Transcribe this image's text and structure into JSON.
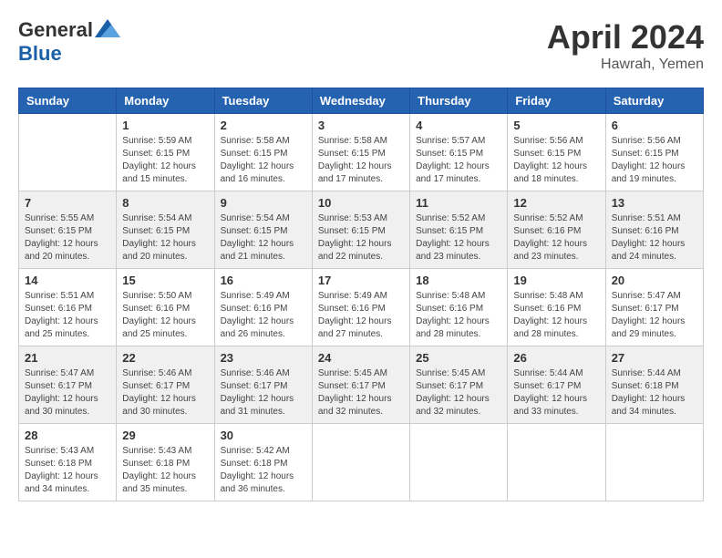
{
  "header": {
    "logo_general": "General",
    "logo_blue": "Blue",
    "month_year": "April 2024",
    "location": "Hawrah, Yemen"
  },
  "days_of_week": [
    "Sunday",
    "Monday",
    "Tuesday",
    "Wednesday",
    "Thursday",
    "Friday",
    "Saturday"
  ],
  "weeks": [
    [
      {
        "day": "",
        "sunrise": "",
        "sunset": "",
        "daylight": ""
      },
      {
        "day": "1",
        "sunrise": "Sunrise: 5:59 AM",
        "sunset": "Sunset: 6:15 PM",
        "daylight": "Daylight: 12 hours and 15 minutes."
      },
      {
        "day": "2",
        "sunrise": "Sunrise: 5:58 AM",
        "sunset": "Sunset: 6:15 PM",
        "daylight": "Daylight: 12 hours and 16 minutes."
      },
      {
        "day": "3",
        "sunrise": "Sunrise: 5:58 AM",
        "sunset": "Sunset: 6:15 PM",
        "daylight": "Daylight: 12 hours and 17 minutes."
      },
      {
        "day": "4",
        "sunrise": "Sunrise: 5:57 AM",
        "sunset": "Sunset: 6:15 PM",
        "daylight": "Daylight: 12 hours and 17 minutes."
      },
      {
        "day": "5",
        "sunrise": "Sunrise: 5:56 AM",
        "sunset": "Sunset: 6:15 PM",
        "daylight": "Daylight: 12 hours and 18 minutes."
      },
      {
        "day": "6",
        "sunrise": "Sunrise: 5:56 AM",
        "sunset": "Sunset: 6:15 PM",
        "daylight": "Daylight: 12 hours and 19 minutes."
      }
    ],
    [
      {
        "day": "7",
        "sunrise": "Sunrise: 5:55 AM",
        "sunset": "Sunset: 6:15 PM",
        "daylight": "Daylight: 12 hours and 20 minutes."
      },
      {
        "day": "8",
        "sunrise": "Sunrise: 5:54 AM",
        "sunset": "Sunset: 6:15 PM",
        "daylight": "Daylight: 12 hours and 20 minutes."
      },
      {
        "day": "9",
        "sunrise": "Sunrise: 5:54 AM",
        "sunset": "Sunset: 6:15 PM",
        "daylight": "Daylight: 12 hours and 21 minutes."
      },
      {
        "day": "10",
        "sunrise": "Sunrise: 5:53 AM",
        "sunset": "Sunset: 6:15 PM",
        "daylight": "Daylight: 12 hours and 22 minutes."
      },
      {
        "day": "11",
        "sunrise": "Sunrise: 5:52 AM",
        "sunset": "Sunset: 6:15 PM",
        "daylight": "Daylight: 12 hours and 23 minutes."
      },
      {
        "day": "12",
        "sunrise": "Sunrise: 5:52 AM",
        "sunset": "Sunset: 6:16 PM",
        "daylight": "Daylight: 12 hours and 23 minutes."
      },
      {
        "day": "13",
        "sunrise": "Sunrise: 5:51 AM",
        "sunset": "Sunset: 6:16 PM",
        "daylight": "Daylight: 12 hours and 24 minutes."
      }
    ],
    [
      {
        "day": "14",
        "sunrise": "Sunrise: 5:51 AM",
        "sunset": "Sunset: 6:16 PM",
        "daylight": "Daylight: 12 hours and 25 minutes."
      },
      {
        "day": "15",
        "sunrise": "Sunrise: 5:50 AM",
        "sunset": "Sunset: 6:16 PM",
        "daylight": "Daylight: 12 hours and 25 minutes."
      },
      {
        "day": "16",
        "sunrise": "Sunrise: 5:49 AM",
        "sunset": "Sunset: 6:16 PM",
        "daylight": "Daylight: 12 hours and 26 minutes."
      },
      {
        "day": "17",
        "sunrise": "Sunrise: 5:49 AM",
        "sunset": "Sunset: 6:16 PM",
        "daylight": "Daylight: 12 hours and 27 minutes."
      },
      {
        "day": "18",
        "sunrise": "Sunrise: 5:48 AM",
        "sunset": "Sunset: 6:16 PM",
        "daylight": "Daylight: 12 hours and 28 minutes."
      },
      {
        "day": "19",
        "sunrise": "Sunrise: 5:48 AM",
        "sunset": "Sunset: 6:16 PM",
        "daylight": "Daylight: 12 hours and 28 minutes."
      },
      {
        "day": "20",
        "sunrise": "Sunrise: 5:47 AM",
        "sunset": "Sunset: 6:17 PM",
        "daylight": "Daylight: 12 hours and 29 minutes."
      }
    ],
    [
      {
        "day": "21",
        "sunrise": "Sunrise: 5:47 AM",
        "sunset": "Sunset: 6:17 PM",
        "daylight": "Daylight: 12 hours and 30 minutes."
      },
      {
        "day": "22",
        "sunrise": "Sunrise: 5:46 AM",
        "sunset": "Sunset: 6:17 PM",
        "daylight": "Daylight: 12 hours and 30 minutes."
      },
      {
        "day": "23",
        "sunrise": "Sunrise: 5:46 AM",
        "sunset": "Sunset: 6:17 PM",
        "daylight": "Daylight: 12 hours and 31 minutes."
      },
      {
        "day": "24",
        "sunrise": "Sunrise: 5:45 AM",
        "sunset": "Sunset: 6:17 PM",
        "daylight": "Daylight: 12 hours and 32 minutes."
      },
      {
        "day": "25",
        "sunrise": "Sunrise: 5:45 AM",
        "sunset": "Sunset: 6:17 PM",
        "daylight": "Daylight: 12 hours and 32 minutes."
      },
      {
        "day": "26",
        "sunrise": "Sunrise: 5:44 AM",
        "sunset": "Sunset: 6:17 PM",
        "daylight": "Daylight: 12 hours and 33 minutes."
      },
      {
        "day": "27",
        "sunrise": "Sunrise: 5:44 AM",
        "sunset": "Sunset: 6:18 PM",
        "daylight": "Daylight: 12 hours and 34 minutes."
      }
    ],
    [
      {
        "day": "28",
        "sunrise": "Sunrise: 5:43 AM",
        "sunset": "Sunset: 6:18 PM",
        "daylight": "Daylight: 12 hours and 34 minutes."
      },
      {
        "day": "29",
        "sunrise": "Sunrise: 5:43 AM",
        "sunset": "Sunset: 6:18 PM",
        "daylight": "Daylight: 12 hours and 35 minutes."
      },
      {
        "day": "30",
        "sunrise": "Sunrise: 5:42 AM",
        "sunset": "Sunset: 6:18 PM",
        "daylight": "Daylight: 12 hours and 36 minutes."
      },
      {
        "day": "",
        "sunrise": "",
        "sunset": "",
        "daylight": ""
      },
      {
        "day": "",
        "sunrise": "",
        "sunset": "",
        "daylight": ""
      },
      {
        "day": "",
        "sunrise": "",
        "sunset": "",
        "daylight": ""
      },
      {
        "day": "",
        "sunrise": "",
        "sunset": "",
        "daylight": ""
      }
    ]
  ]
}
